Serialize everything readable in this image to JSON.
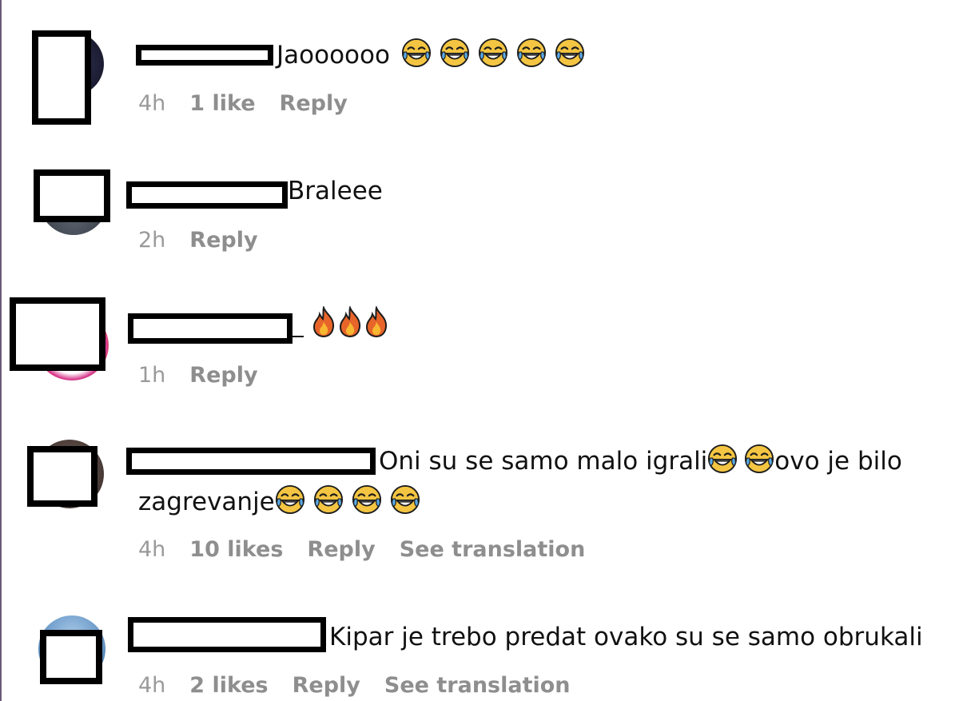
{
  "comments": [
    {
      "text": "Jaoooooo",
      "emojis": [
        "face-with-tears-of-joy-icon",
        "face-with-tears-of-joy-icon",
        "face-with-tears-of-joy-icon",
        "face-with-tears-of-joy-icon",
        "face-with-tears-of-joy-icon"
      ],
      "time": "4h",
      "likes": "1 like",
      "reply": "Reply"
    },
    {
      "text": "Braleee",
      "time": "2h",
      "reply": "Reply"
    },
    {
      "text": "",
      "emojis": [
        "fire-icon",
        "fire-icon",
        "fire-icon"
      ],
      "time": "1h",
      "reply": "Reply"
    },
    {
      "text_part1": "Oni su se samo malo igrali",
      "text_part2": "ovo je bilo",
      "text_line2": "zagrevanje",
      "time": "4h",
      "likes": "10 likes",
      "reply": "Reply",
      "translate": "See translation"
    },
    {
      "text": "Kipar je trebo predat ovako su se samo obrukali",
      "time": "4h",
      "likes": "2 likes",
      "reply": "Reply",
      "translate": "See translation"
    }
  ],
  "colors": {
    "meta_text": "#8e8e8e",
    "redaction": "#000000",
    "laugh_face": "#f4c542",
    "tear": "#5aa9e6",
    "fire_outer": "#e8652a",
    "fire_inner": "#f7b731"
  }
}
